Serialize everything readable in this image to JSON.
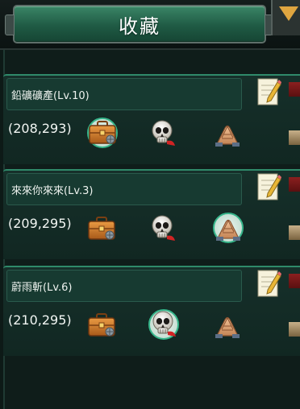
{
  "header": {
    "title": "收藏"
  },
  "entries": [
    {
      "name": "鉛礦礦產(Lv.10)",
      "coords": "(208,293)",
      "selected_type": "resource"
    },
    {
      "name": "來來你來來(Lv.3)",
      "coords": "(209,295)",
      "selected_type": "ally"
    },
    {
      "name": "蔚雨斬(Lv.6)",
      "coords": "(210,295)",
      "selected_type": "enemy"
    }
  ],
  "icons": {
    "resource": "briefcase-icon",
    "enemy": "skull-icon",
    "ally": "handshake-icon",
    "edit": "note-pencil-icon"
  }
}
